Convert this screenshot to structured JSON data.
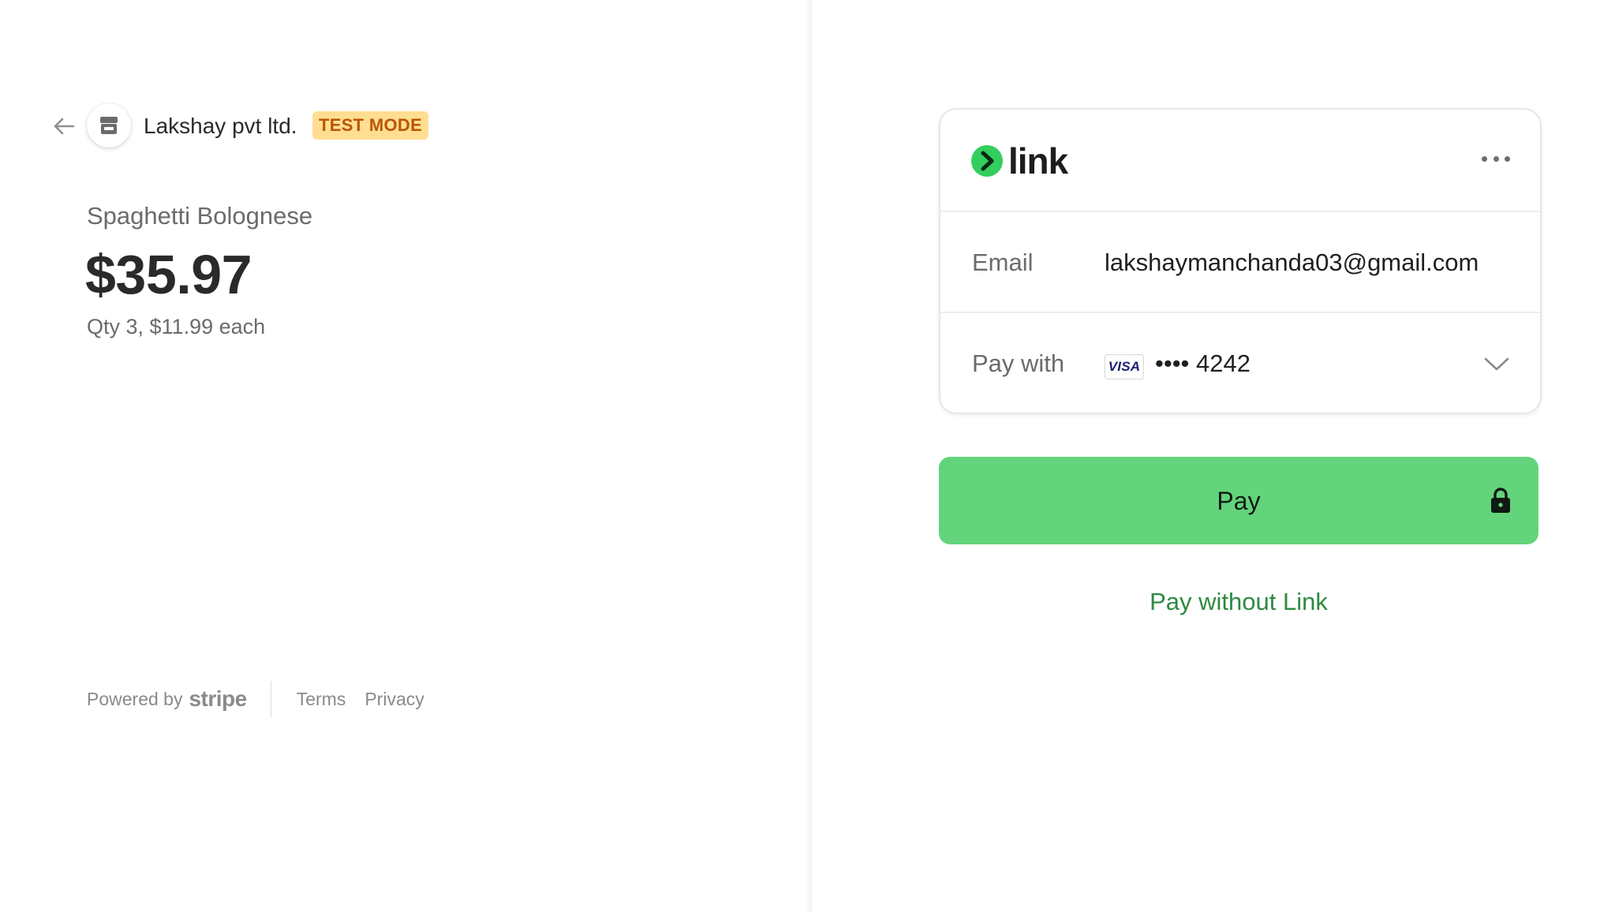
{
  "merchant": {
    "name": "Lakshay pvt ltd.",
    "badge": "TEST MODE"
  },
  "product": {
    "name": "Spaghetti Bolognese",
    "price": "$35.97",
    "quantity_text": "Qty 3, $11.99 each"
  },
  "footer": {
    "powered_by": "Powered by",
    "brand": "stripe",
    "terms": "Terms",
    "privacy": "Privacy"
  },
  "link_card": {
    "logo_text": "link",
    "email_label": "Email",
    "email_value": "lakshaymanchanda03@gmail.com",
    "pay_with_label": "Pay with",
    "card_brand": "VISA",
    "card_number": "•••• 4242"
  },
  "actions": {
    "pay_label": "Pay",
    "pay_without_link": "Pay without Link"
  },
  "icons": {
    "back": "arrow-left-icon",
    "store": "store-icon",
    "link_logo": "link-logo-icon",
    "more": "more-dots-icon",
    "chevron": "chevron-down-icon",
    "lock": "lock-icon"
  },
  "colors": {
    "pay_button": "#63d47b",
    "pay_without_link": "#2e8a41",
    "test_badge_bg": "#ffde92",
    "test_badge_text": "#bb5504",
    "link_green": "#33ce5e"
  }
}
